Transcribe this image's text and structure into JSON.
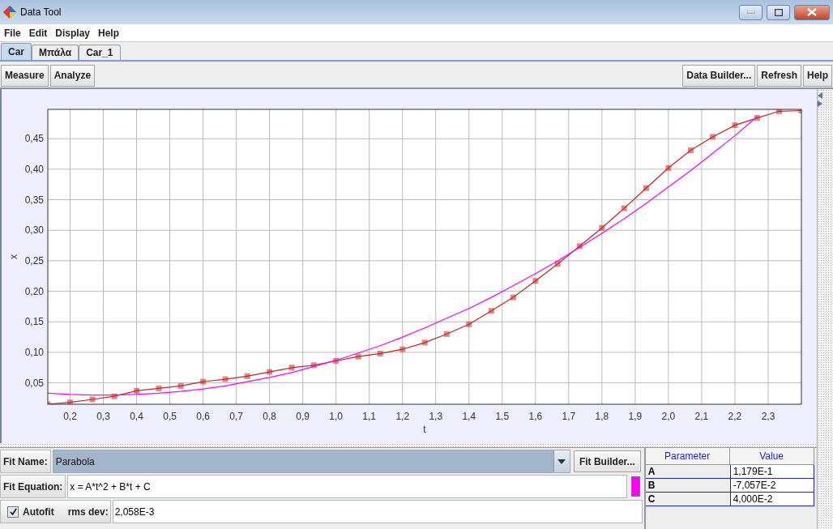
{
  "window": {
    "title": "Data Tool"
  },
  "menu": [
    "File",
    "Edit",
    "Display",
    "Help"
  ],
  "tabs": [
    {
      "label": "Car",
      "selected": true
    },
    {
      "label": "Μπάλα",
      "selected": false
    },
    {
      "label": "Car_1",
      "selected": false
    }
  ],
  "toolbar": {
    "left_buttons": [
      "Measure",
      "Analyze"
    ],
    "right_buttons": [
      "Data Builder...",
      "Refresh",
      "Help"
    ]
  },
  "plot": {
    "chart_data": {
      "type": "line",
      "xlabel": "t",
      "ylabel": "x",
      "grid": true,
      "x": [
        0.133,
        0.2,
        0.267,
        0.333,
        0.4,
        0.467,
        0.533,
        0.6,
        0.667,
        0.733,
        0.8,
        0.867,
        0.933,
        1.0,
        1.067,
        1.133,
        1.2,
        1.267,
        1.333,
        1.4,
        1.467,
        1.533,
        1.6,
        1.667,
        1.733,
        1.8,
        1.867,
        1.933,
        2.0,
        2.067,
        2.133,
        2.2,
        2.267,
        2.333,
        2.4
      ],
      "series": [
        {
          "color": "#cc2222",
          "marker": "square",
          "values": [
            0.015,
            0.018,
            0.023,
            0.028,
            0.037,
            0.041,
            0.045,
            0.052,
            0.056,
            0.061,
            0.068,
            0.075,
            0.079,
            0.086,
            0.093,
            0.098,
            0.105,
            0.116,
            0.13,
            0.146,
            0.168,
            0.19,
            0.217,
            0.245,
            0.274,
            0.304,
            0.336,
            0.369,
            0.402,
            0.431,
            0.453,
            0.472,
            0.484,
            0.495,
            0.496
          ]
        },
        {
          "color": "#ff00ff",
          "values": [
            0.033,
            0.031,
            0.03,
            0.03,
            0.031,
            0.033,
            0.036,
            0.04,
            0.045,
            0.052,
            0.059,
            0.067,
            0.077,
            0.087,
            0.099,
            0.111,
            0.125,
            0.14,
            0.156,
            0.172,
            0.19,
            0.209,
            0.229,
            0.25,
            0.272,
            0.295,
            0.319,
            0.344,
            0.371,
            0.398,
            0.426,
            0.455,
            0.486,
            null,
            null
          ]
        }
      ],
      "xlim": [
        0.133,
        2.4
      ],
      "ylim": [
        0.015,
        0.498
      ],
      "xticks": [
        {
          "value": 0.2,
          "label": "0,2"
        },
        {
          "value": 0.3,
          "label": "0,3"
        },
        {
          "value": 0.4,
          "label": "0,4"
        },
        {
          "value": 0.5,
          "label": "0,5"
        },
        {
          "value": 0.6,
          "label": "0,6"
        },
        {
          "value": 0.7,
          "label": "0,7"
        },
        {
          "value": 0.8,
          "label": "0,8"
        },
        {
          "value": 0.9,
          "label": "0,9"
        },
        {
          "value": 1.0,
          "label": "1,0"
        },
        {
          "value": 1.1,
          "label": "1,1"
        },
        {
          "value": 1.2,
          "label": "1,2"
        },
        {
          "value": 1.3,
          "label": "1,3"
        },
        {
          "value": 1.4,
          "label": "1,4"
        },
        {
          "value": 1.5,
          "label": "1,5"
        },
        {
          "value": 1.6,
          "label": "1,6"
        },
        {
          "value": 1.7,
          "label": "1,7"
        },
        {
          "value": 1.8,
          "label": "1,8"
        },
        {
          "value": 1.9,
          "label": "1,9"
        },
        {
          "value": 2.0,
          "label": "2,0"
        },
        {
          "value": 2.1,
          "label": "2,1"
        },
        {
          "value": 2.2,
          "label": "2,2"
        },
        {
          "value": 2.3,
          "label": "2,3"
        }
      ],
      "yticks": [
        {
          "value": 0.05,
          "label": "0,05"
        },
        {
          "value": 0.1,
          "label": "0,10"
        },
        {
          "value": 0.15,
          "label": "0,15"
        },
        {
          "value": 0.2,
          "label": "0,20"
        },
        {
          "value": 0.25,
          "label": "0,25"
        },
        {
          "value": 0.3,
          "label": "0,30"
        },
        {
          "value": 0.35,
          "label": "0,35"
        },
        {
          "value": 0.4,
          "label": "0,40"
        },
        {
          "value": 0.45,
          "label": "0,45"
        }
      ]
    }
  },
  "fit": {
    "name_label": "Fit Name:",
    "name": "Parabola",
    "builder_button": "Fit Builder...",
    "equation_label": "Fit Equation:",
    "equation": "x = A*t^2 + B*t + C",
    "color": "#ff00ff",
    "autofit": {
      "label": "Autofit",
      "checked": true
    },
    "rms_label": "rms dev:",
    "rms": "2,058E-3"
  },
  "parameters": {
    "columns": [
      "Parameter",
      "Value"
    ],
    "rows": [
      {
        "name": "A",
        "value": "1,179E-1"
      },
      {
        "name": "B",
        "value": "-7,057E-2"
      },
      {
        "name": "C",
        "value": "4,000E-2"
      }
    ]
  }
}
